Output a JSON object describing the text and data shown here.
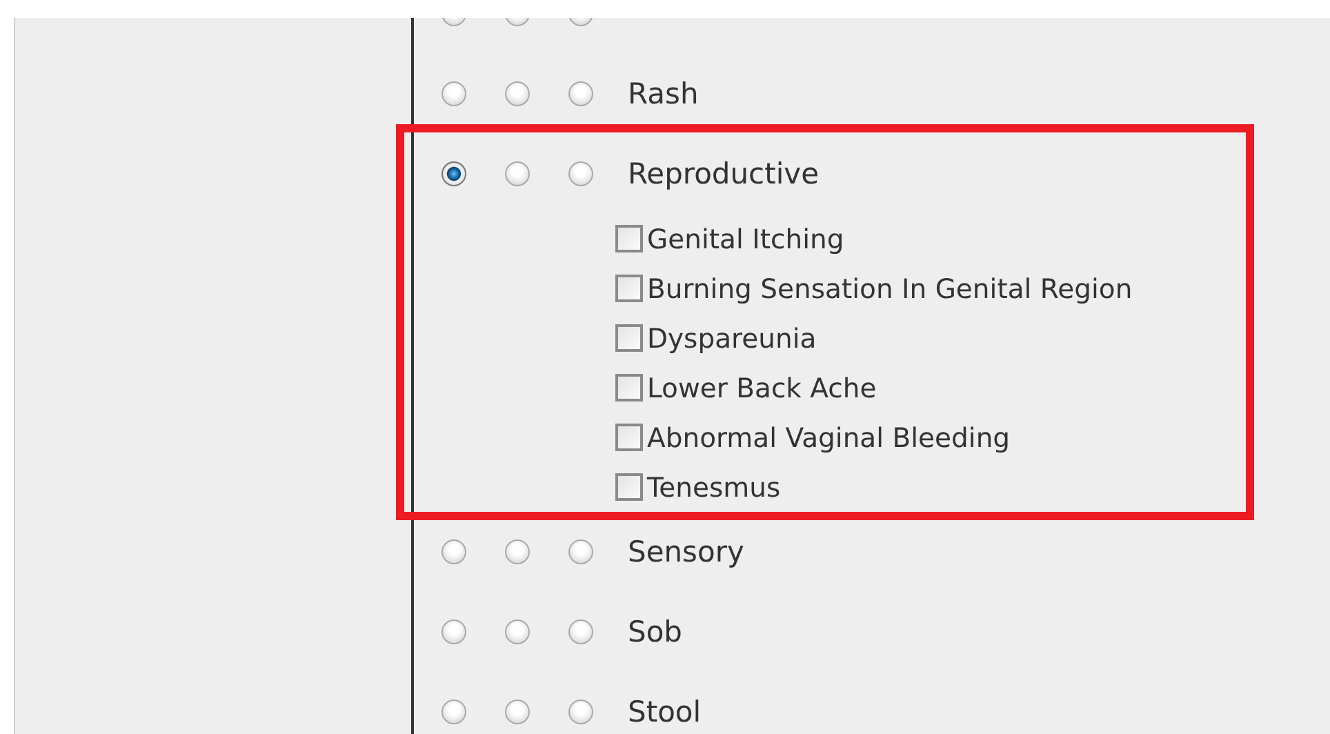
{
  "symptoms": [
    {
      "highlighted": false,
      "radios": [
        {
          "selected": false
        },
        {
          "selected": false
        },
        {
          "selected": false
        }
      ]
    },
    {
      "label": "Rash",
      "highlighted": false,
      "radios": [
        {
          "selected": false
        },
        {
          "selected": false
        },
        {
          "selected": false
        }
      ]
    },
    {
      "label": "Reproductive",
      "highlighted": true,
      "radios": [
        {
          "selected": true
        },
        {
          "selected": false
        },
        {
          "selected": false
        }
      ],
      "sub_items": [
        {
          "label": "Genital Itching",
          "checked": false
        },
        {
          "label": "Burning Sensation In Genital Region",
          "checked": false
        },
        {
          "label": "Dyspareunia",
          "checked": false
        },
        {
          "label": "Lower Back Ache",
          "checked": false
        },
        {
          "label": "Abnormal Vaginal Bleeding",
          "checked": false
        },
        {
          "label": "Tenesmus",
          "checked": false
        }
      ]
    },
    {
      "label": "Sensory",
      "highlighted": false,
      "radios": [
        {
          "selected": false
        },
        {
          "selected": false
        },
        {
          "selected": false
        }
      ]
    },
    {
      "label": "Sob",
      "highlighted": false,
      "radios": [
        {
          "selected": false
        },
        {
          "selected": false
        },
        {
          "selected": false
        }
      ]
    },
    {
      "label": "Stool",
      "highlighted": false,
      "radios": [
        {
          "selected": false
        },
        {
          "selected": false
        },
        {
          "selected": false
        }
      ]
    }
  ]
}
